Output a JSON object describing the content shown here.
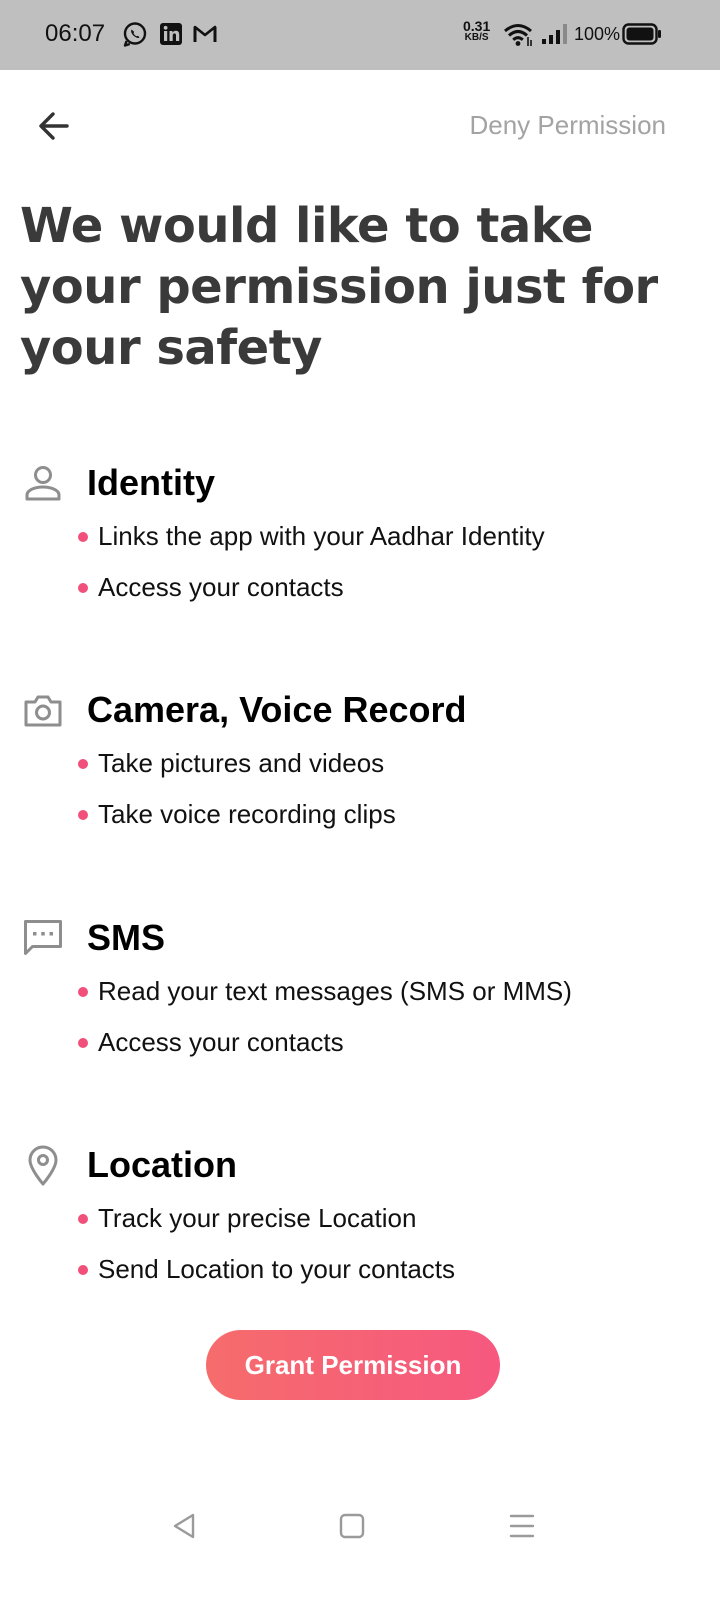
{
  "status_bar": {
    "time": "06:07",
    "apps": [
      "whatsapp-icon",
      "linkedin-icon",
      "gmail-icon"
    ],
    "net_speed_value": "0.31",
    "net_speed_unit": "KB/S",
    "battery": "100%"
  },
  "header": {
    "back_icon": "arrow-left-icon",
    "deny_label": "Deny Permission"
  },
  "title": "We would like to take your permission just for your safety",
  "sections": [
    {
      "icon": "person-icon",
      "title": "Identity",
      "items": [
        "Links the app with your Aadhar Identity",
        "Access your contacts"
      ]
    },
    {
      "icon": "camera-icon",
      "title": "Camera, Voice Record",
      "items": [
        "Take pictures and videos",
        "Take voice recording clips"
      ]
    },
    {
      "icon": "message-icon",
      "title": "SMS",
      "items": [
        "Read your text messages (SMS or MMS)",
        "Access your contacts"
      ]
    },
    {
      "icon": "location-pin-icon",
      "title": "Location",
      "items": [
        "Track your precise Location",
        "Send Location to your contacts"
      ]
    }
  ],
  "grant_label": "Grant Permission",
  "colors": {
    "accent_gradient_start": "#f66c6c",
    "accent_gradient_end": "#f6587f",
    "bullet": "#f0507a",
    "title": "#3a3a3a",
    "deny": "#a3a3a3",
    "status_bar_bg": "#bfbfbf"
  },
  "nav": [
    "back-triangle-icon",
    "home-square-icon",
    "menu-lines-icon"
  ]
}
